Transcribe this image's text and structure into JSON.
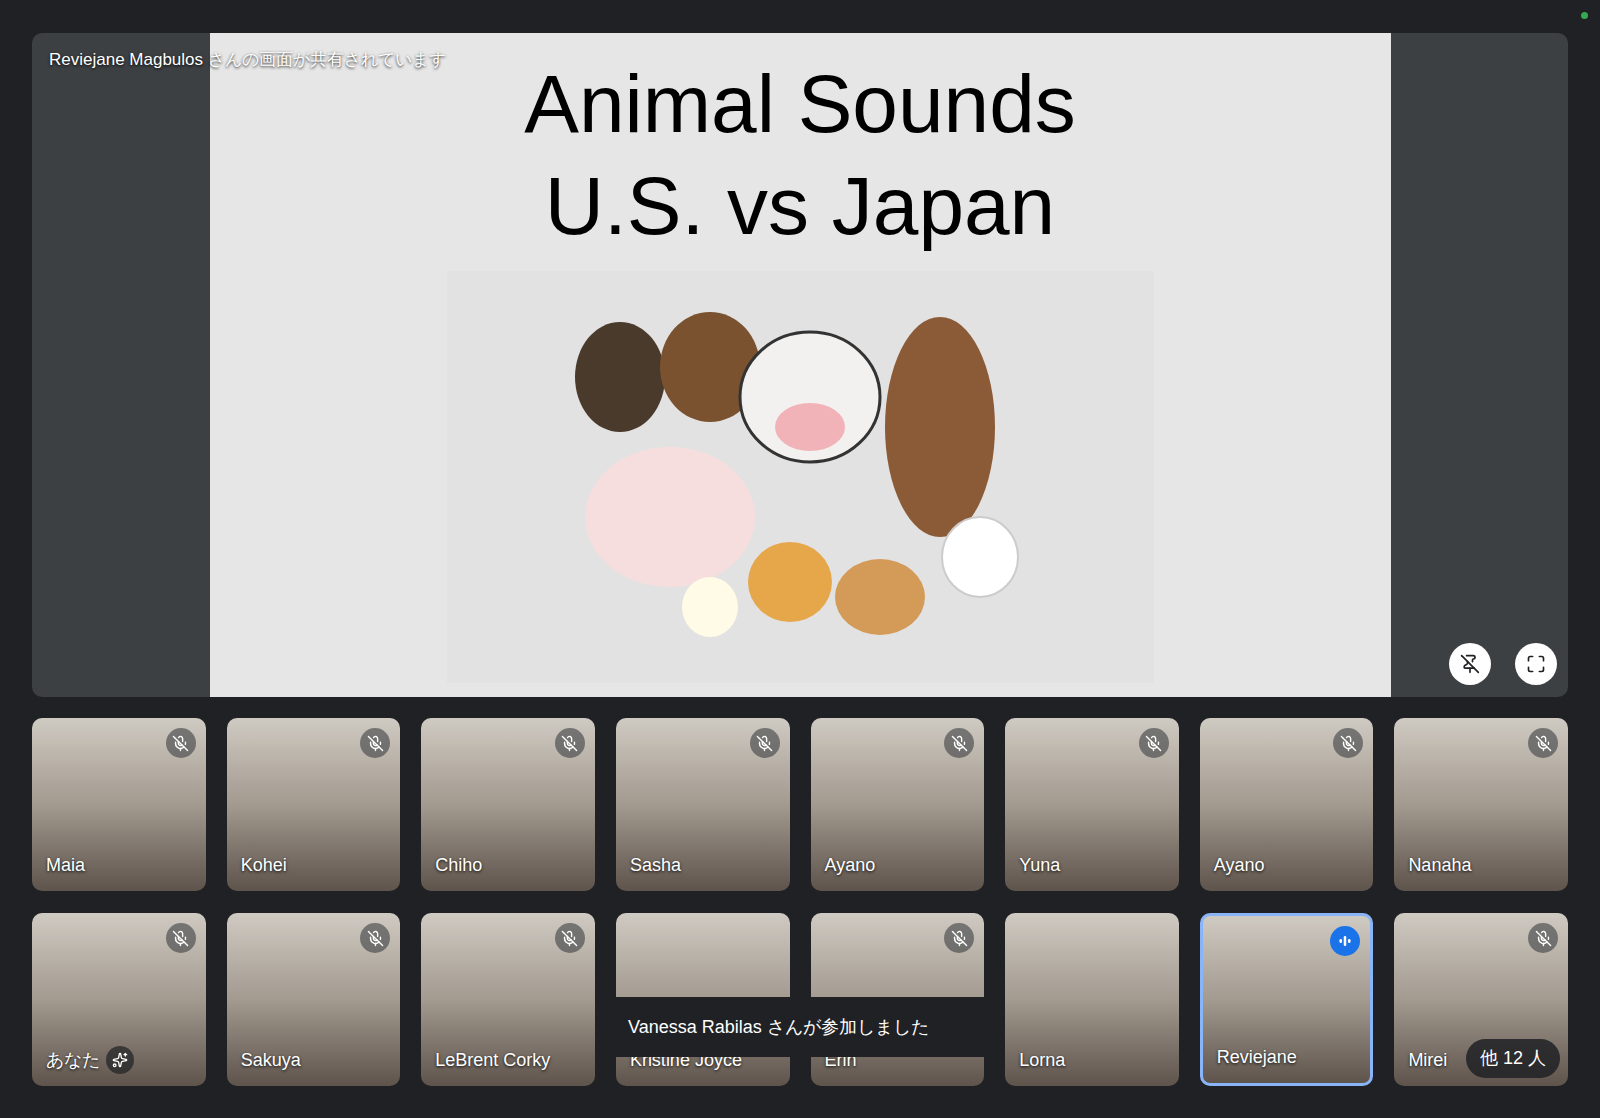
{
  "connection": {
    "ok": true
  },
  "stage": {
    "banner": "Reviejane Magbulos さんの画面が共有されています",
    "pinned": true,
    "slide": {
      "title_lines": [
        "Animal Sounds",
        "U.S. vs Japan"
      ]
    }
  },
  "participants": [
    {
      "name": "Maia",
      "muted": true,
      "speaking": false,
      "selected": false,
      "effects": false
    },
    {
      "name": "Kohei",
      "muted": true,
      "speaking": false,
      "selected": false,
      "effects": false
    },
    {
      "name": "Chiho",
      "muted": true,
      "speaking": false,
      "selected": false,
      "effects": false
    },
    {
      "name": "Sasha",
      "muted": true,
      "speaking": false,
      "selected": false,
      "effects": false
    },
    {
      "name": "Ayano",
      "muted": true,
      "speaking": false,
      "selected": false,
      "effects": false
    },
    {
      "name": "Yuna",
      "muted": true,
      "speaking": false,
      "selected": false,
      "effects": false
    },
    {
      "name": "Ayano",
      "muted": true,
      "speaking": false,
      "selected": false,
      "effects": false
    },
    {
      "name": "Nanaha",
      "muted": true,
      "speaking": false,
      "selected": false,
      "effects": false
    },
    {
      "name": "あなた",
      "muted": true,
      "speaking": false,
      "selected": false,
      "effects": true
    },
    {
      "name": "Sakuya",
      "muted": true,
      "speaking": false,
      "selected": false,
      "effects": false
    },
    {
      "name": "LeBrent Corky",
      "muted": true,
      "speaking": false,
      "selected": false,
      "effects": false
    },
    {
      "name": "Kristine Joyce",
      "muted": false,
      "speaking": false,
      "selected": false,
      "effects": false
    },
    {
      "name": "Erin",
      "muted": true,
      "speaking": false,
      "selected": false,
      "effects": false
    },
    {
      "name": "Lorna",
      "muted": false,
      "speaking": false,
      "selected": false,
      "effects": false
    },
    {
      "name": "Reviejane",
      "muted": false,
      "speaking": true,
      "selected": true,
      "effects": false
    },
    {
      "name": "Mirei",
      "muted": true,
      "speaking": false,
      "selected": false,
      "effects": false
    }
  ],
  "overflow": {
    "label": "他 12 人"
  },
  "toast": {
    "text": "Vanessa Rabilas さんが参加しました"
  }
}
